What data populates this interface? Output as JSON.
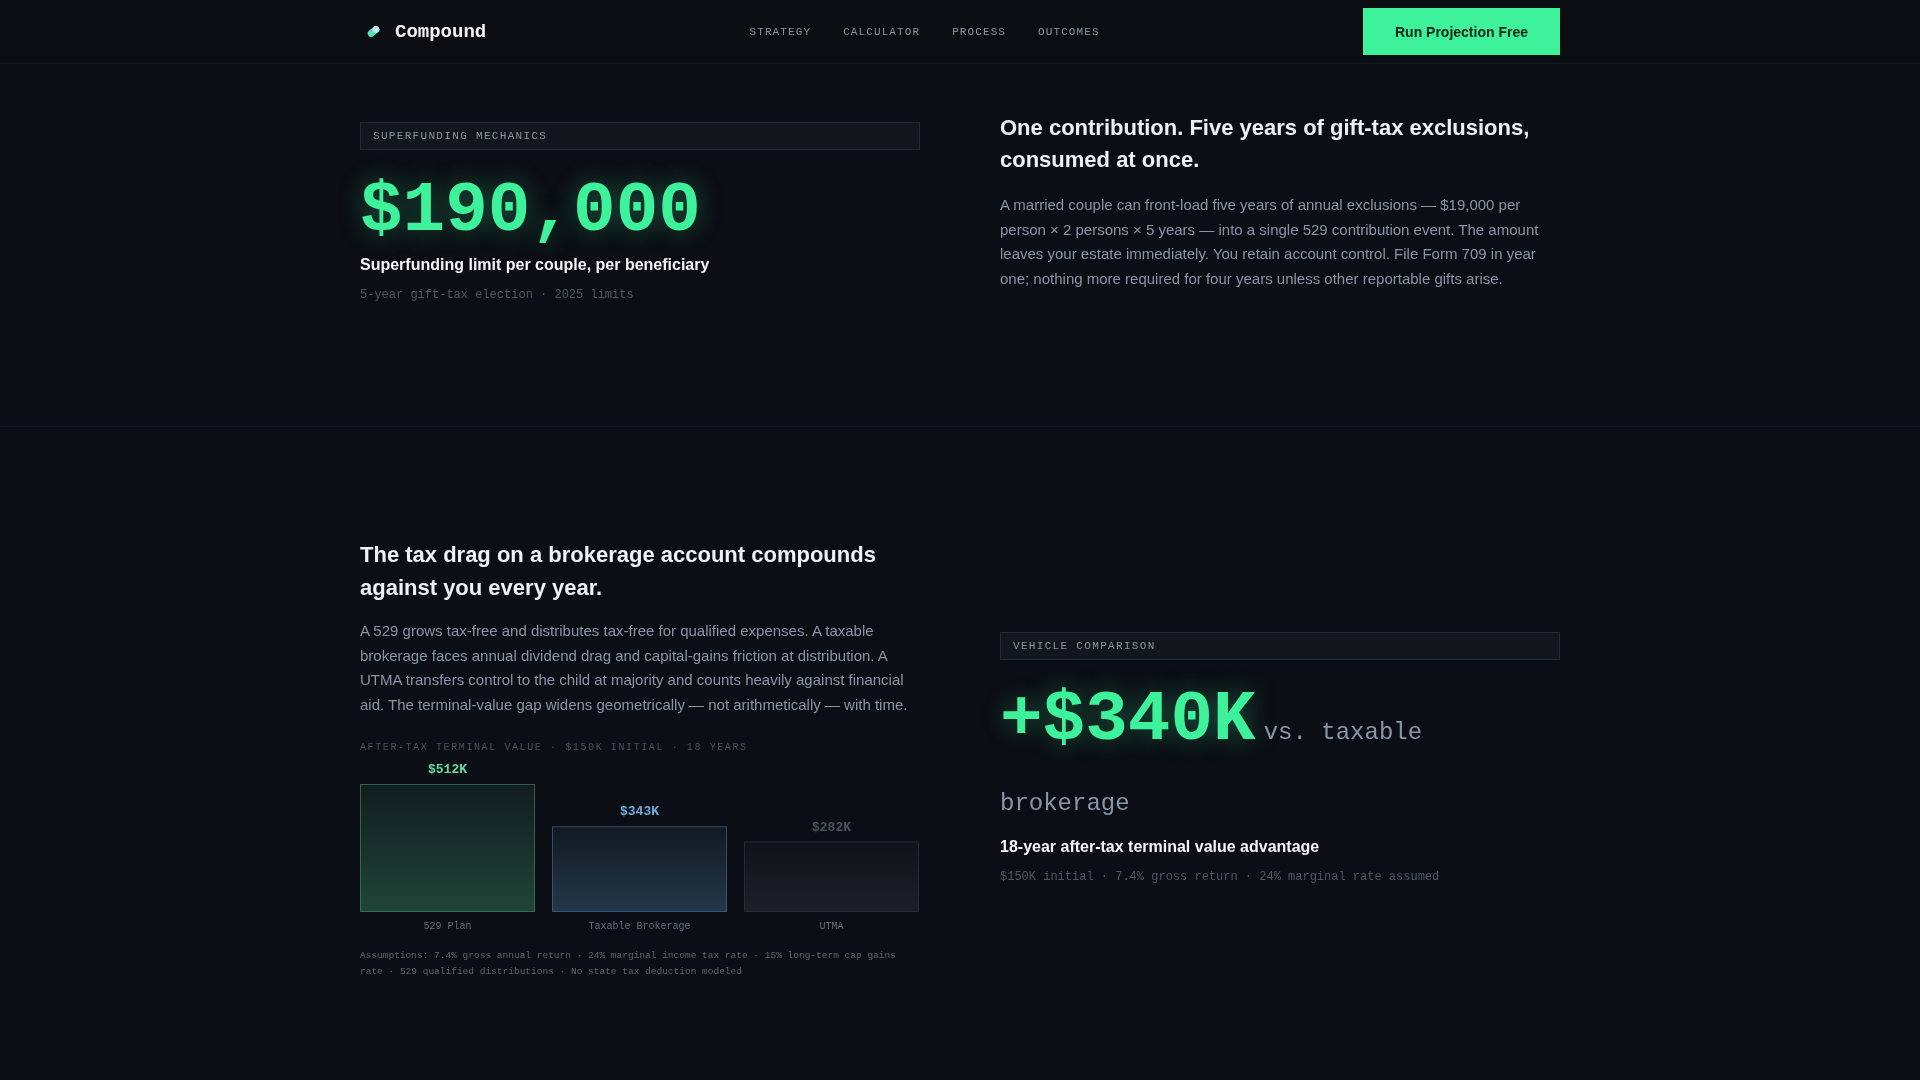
{
  "header": {
    "brand": "Compound",
    "nav": [
      "STRATEGY",
      "CALCULATOR",
      "PROCESS",
      "OUTCOMES"
    ],
    "cta": "Run Projection Free"
  },
  "superfunding": {
    "tag": "SUPERFUNDING MECHANICS",
    "value": "$190,000",
    "caption": "Superfunding limit per couple, per beneficiary",
    "note": "5-year gift-tax election · 2025 limits",
    "heading": "One contribution. Five years of gift-tax exclusions, consumed at once.",
    "body": "A married couple can front-load five years of annual exclusions — $19,000 per person × 2 persons × 5 years — into a single 529 contribution event. The amount leaves your estate immediately. You retain account control. File Form 709 in year one; nothing more required for four years unless other reportable gifts arise."
  },
  "tax_drag": {
    "heading": "The tax drag on a brokerage account compounds against you every year.",
    "body": "A 529 grows tax-free and distributes tax-free for qualified expenses. A taxable brokerage faces annual dividend drag and capital-gains friction at distribution. A UTMA transfers control to the child at majority and counts heavily against financial aid. The terminal-value gap widens geometrically — not arithmetically — with time.",
    "chart_data": {
      "type": "bar",
      "title": "AFTER-TAX TERMINAL VALUE · $150K INITIAL · 18 YEARS",
      "categories": [
        "529 Plan",
        "Taxable Brokerage",
        "UTMA"
      ],
      "values": [
        512,
        343,
        282
      ],
      "colors": [
        "#5ee0a0",
        "#6aaee0",
        "#4a525e"
      ],
      "value_labels": [
        "$512K",
        "$343K",
        "$282K"
      ]
    },
    "assumptions": "Assumptions: 7.4% gross annual return · 24% marginal income tax rate · 15% long-term cap gains rate · 529 qualified distributions · No state tax deduction modeled"
  },
  "comparison": {
    "tag": "VEHICLE COMPARISON",
    "value": "+$340K",
    "suffix": "vs. taxable brokerage",
    "caption": "18-year after-tax terminal value advantage",
    "note": "$150K initial · 7.4% gross return · 24% marginal rate assumed"
  }
}
